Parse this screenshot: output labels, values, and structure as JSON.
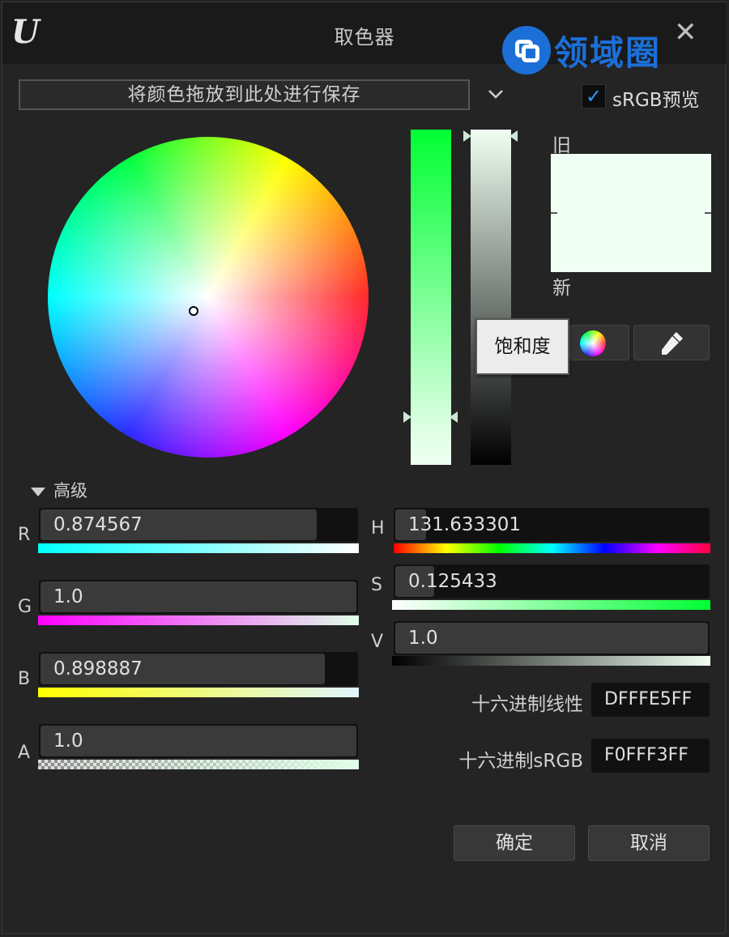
{
  "window": {
    "title": "取色器",
    "logo": "U"
  },
  "watermark": {
    "text": "领域圈",
    "color": "#1c6fd6"
  },
  "save_zone": {
    "label": "将颜色拖放到此处进行保存"
  },
  "srgb_preview": {
    "label": "sRGB预览",
    "checked": true
  },
  "preview": {
    "old_label": "旧",
    "new_label": "新",
    "old_color": "#f0fff3",
    "new_color": "#f0fff3"
  },
  "tooltip": {
    "text": "饱和度"
  },
  "advanced": {
    "label": "高级",
    "expanded": true
  },
  "rgba": [
    {
      "label": "R",
      "value": "0.874567",
      "fill": 0.874567
    },
    {
      "label": "G",
      "value": "1.0",
      "fill": 1.0
    },
    {
      "label": "B",
      "value": "0.898887",
      "fill": 0.898887
    },
    {
      "label": "A",
      "value": "1.0",
      "fill": 1.0
    }
  ],
  "hsv": [
    {
      "label": "H",
      "value": "131.633301",
      "fill": 0.0
    },
    {
      "label": "S",
      "value": "0.125433",
      "fill": 0.125433
    },
    {
      "label": "V",
      "value": "1.0",
      "fill": 1.0
    }
  ],
  "hex": {
    "linear_label": "十六进制线性",
    "linear_value": "DFFFE5FF",
    "srgb_label": "十六进制sRGB",
    "srgb_value": "F0FFF3FF"
  },
  "buttons": {
    "ok": "确定",
    "cancel": "取消"
  },
  "icons": {
    "close": "close-icon",
    "eyedropper": "eyedropper-icon",
    "color_wheel": "color-wheel-icon",
    "checkbox": "checkmark-icon"
  }
}
